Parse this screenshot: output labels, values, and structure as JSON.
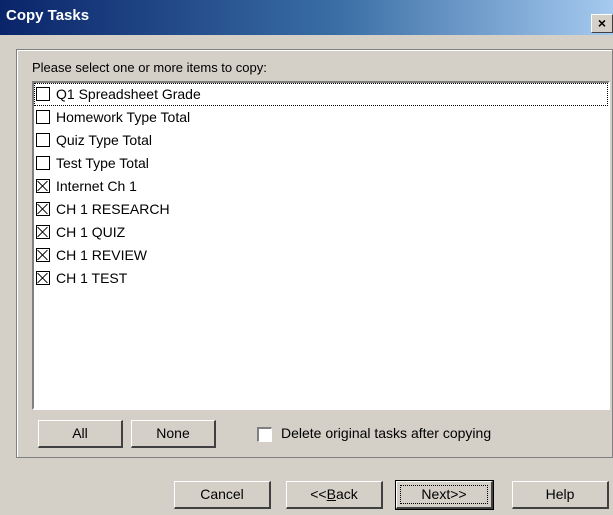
{
  "window": {
    "title": "Copy Tasks",
    "close_glyph": "×"
  },
  "group_label": "Please select one or more items to copy:",
  "items": [
    {
      "label": "Q1 Spreadsheet Grade",
      "checked": false
    },
    {
      "label": "Homework Type Total",
      "checked": false
    },
    {
      "label": "Quiz Type Total",
      "checked": false
    },
    {
      "label": "Test Type Total",
      "checked": false
    },
    {
      "label": "Internet Ch 1",
      "checked": true
    },
    {
      "label": "CH 1 RESEARCH",
      "checked": true
    },
    {
      "label": "CH 1 QUIZ",
      "checked": true
    },
    {
      "label": "CH 1 REVIEW",
      "checked": true
    },
    {
      "label": "CH 1 TEST",
      "checked": true
    }
  ],
  "buttons": {
    "all": "All",
    "none": "None",
    "cancel": "Cancel",
    "back_prefix": "<<",
    "back_mnemonic": "B",
    "back_rest": "ack",
    "next": "Next>>",
    "help": "Help"
  },
  "delete_original": {
    "label": "Delete original tasks after copying",
    "checked": false
  }
}
